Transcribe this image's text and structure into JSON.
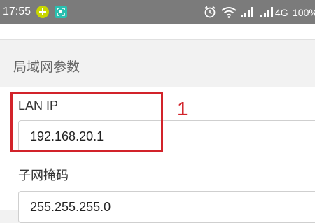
{
  "status_bar": {
    "time": "17:55",
    "network_type": "4G",
    "battery": "100%",
    "icons": [
      "plus-notification-icon",
      "screenshot-icon",
      "alarm-icon",
      "wifi-icon",
      "signal-icon",
      "signal-4g-icon"
    ],
    "background_color": "#7b7b7b"
  },
  "section": {
    "title": "局域网参数"
  },
  "fields": {
    "lan_ip": {
      "label": "LAN IP",
      "value": "192.168.20.1"
    },
    "subnet_mask": {
      "label": "子网掩码",
      "value": "255.255.255.0"
    }
  },
  "annotation": {
    "number": "1",
    "color": "#d2232a"
  }
}
